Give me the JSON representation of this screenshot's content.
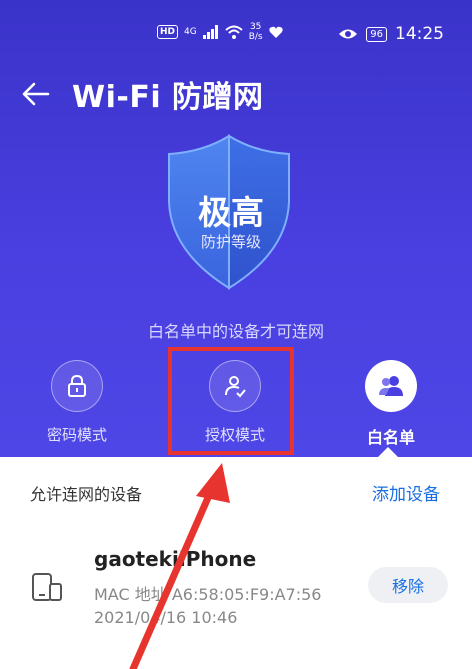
{
  "status_bar": {
    "hd": "HD",
    "network": "4G",
    "speed_value": "35",
    "speed_unit": "B/s",
    "battery": "96",
    "time": "14:25"
  },
  "header": {
    "title": "Wi-Fi 防蹭网"
  },
  "protection": {
    "level_value": "极高",
    "level_label": "防护等级",
    "hint": "白名单中的设备才可连网"
  },
  "modes": [
    {
      "label": "密码模式",
      "icon": "lock-icon"
    },
    {
      "label": "授权模式",
      "icon": "user-check-icon"
    },
    {
      "label": "白名单",
      "icon": "users-icon",
      "active": true
    }
  ],
  "devices_section": {
    "title": "允许连网的设备",
    "add_label": "添加设备"
  },
  "devices": [
    {
      "name": "gaotekiiPhone",
      "mac": "MAC 地址 A6:58:05:F9:A7:56",
      "time": "2021/04/16 10:46",
      "remove_label": "移除"
    }
  ],
  "colors": {
    "hero_bg": "#4a3fe0",
    "accent": "#1a6fe0",
    "annotation": "#e8342f"
  }
}
